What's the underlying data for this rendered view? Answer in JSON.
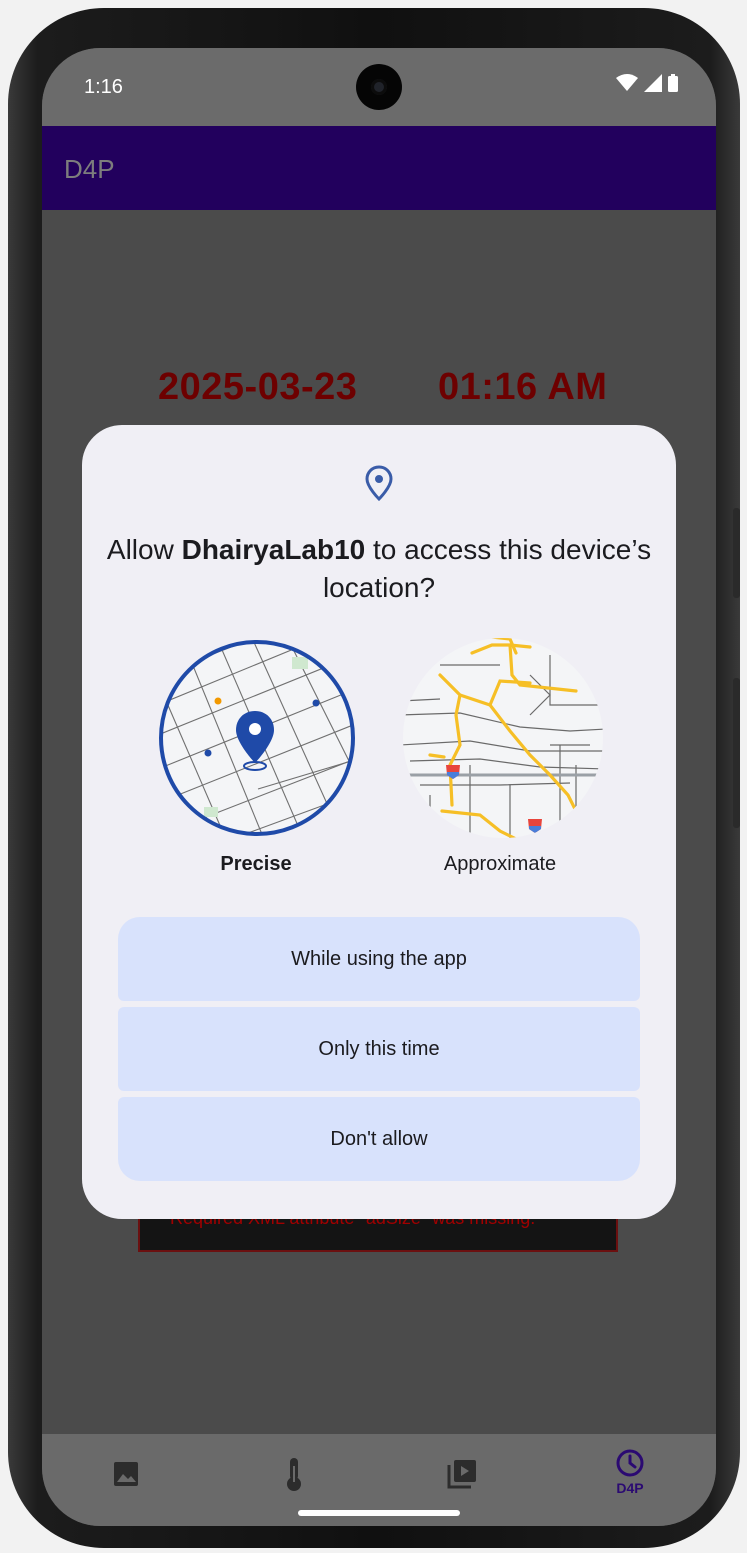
{
  "status_bar": {
    "time": "1:16",
    "wifi_icon": "wifi-icon",
    "signal_icon": "signal-icon",
    "battery_icon": "battery-icon"
  },
  "app_bar": {
    "title": "D4P",
    "color": "#22005d"
  },
  "content": {
    "date": "2025-03-23",
    "time": "01:16 AM",
    "error_text": "Required XML attribute \"adSize\" was missing."
  },
  "dialog": {
    "icon": "location-pin-icon",
    "title_prefix": "Allow ",
    "app_name": "DhairyaLab10",
    "title_suffix": " to access this device’s location?",
    "options": {
      "precise": "Precise",
      "approximate": "Approximate"
    },
    "buttons": {
      "while_using": "While using the app",
      "only_this_time": "Only this time",
      "dont_allow": "Don't allow"
    },
    "accent_color": "#1f4aa8",
    "button_color": "#d8e2fc"
  },
  "bottom_nav": {
    "items": [
      {
        "icon": "image-icon",
        "label": ""
      },
      {
        "icon": "thermometer-icon",
        "label": ""
      },
      {
        "icon": "video-library-icon",
        "label": ""
      },
      {
        "icon": "clock-icon",
        "label": "D4P",
        "selected": true
      }
    ]
  }
}
